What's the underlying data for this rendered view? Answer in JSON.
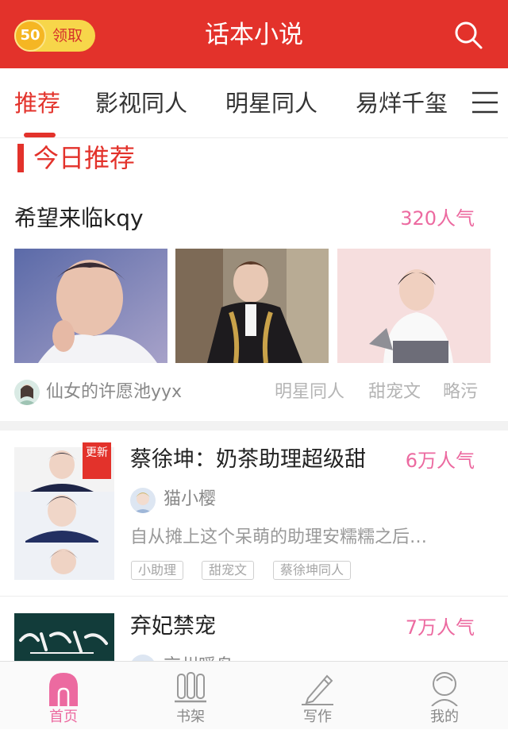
{
  "header": {
    "coin_count": "50",
    "coin_label": "领取",
    "title": "话本小说",
    "search_icon": "search-icon"
  },
  "tabs": [
    {
      "label": "推荐",
      "active": true
    },
    {
      "label": "影视同人",
      "active": false
    },
    {
      "label": "明星同人",
      "active": false
    },
    {
      "label": "易烊千玺",
      "active": false
    }
  ],
  "tab_menu_icon": "menu-icon",
  "section": {
    "title": "今日推荐"
  },
  "featured": {
    "title": "希望来临kqy",
    "popularity": "320人气",
    "author": "仙女的许愿池yyx",
    "tags": [
      "明星同人",
      "甜宠文",
      "略污"
    ]
  },
  "list": [
    {
      "badge": "更新",
      "title": "蔡徐坤：奶茶助理超级甜",
      "popularity": "6万人气",
      "author": "猫小樱",
      "description": "自从摊上这个呆萌的助理安糯糯之后…",
      "tags": [
        "小助理",
        "甜宠文",
        "蔡徐坤同人"
      ]
    },
    {
      "title": "弃妃禁宠",
      "popularity": "7万人气",
      "author": "京州暖鸟"
    }
  ],
  "bottom_nav": [
    {
      "label": "首页",
      "icon": "home-icon",
      "active": true
    },
    {
      "label": "书架",
      "icon": "bookshelf-icon",
      "active": false
    },
    {
      "label": "写作",
      "icon": "pencil-icon",
      "active": false
    },
    {
      "label": "我的",
      "icon": "profile-icon",
      "active": false
    }
  ],
  "colors": {
    "brand_red": "#e3322b",
    "popularity_pink": "#ec6aa0",
    "coin_gold": "#f7d64a"
  }
}
